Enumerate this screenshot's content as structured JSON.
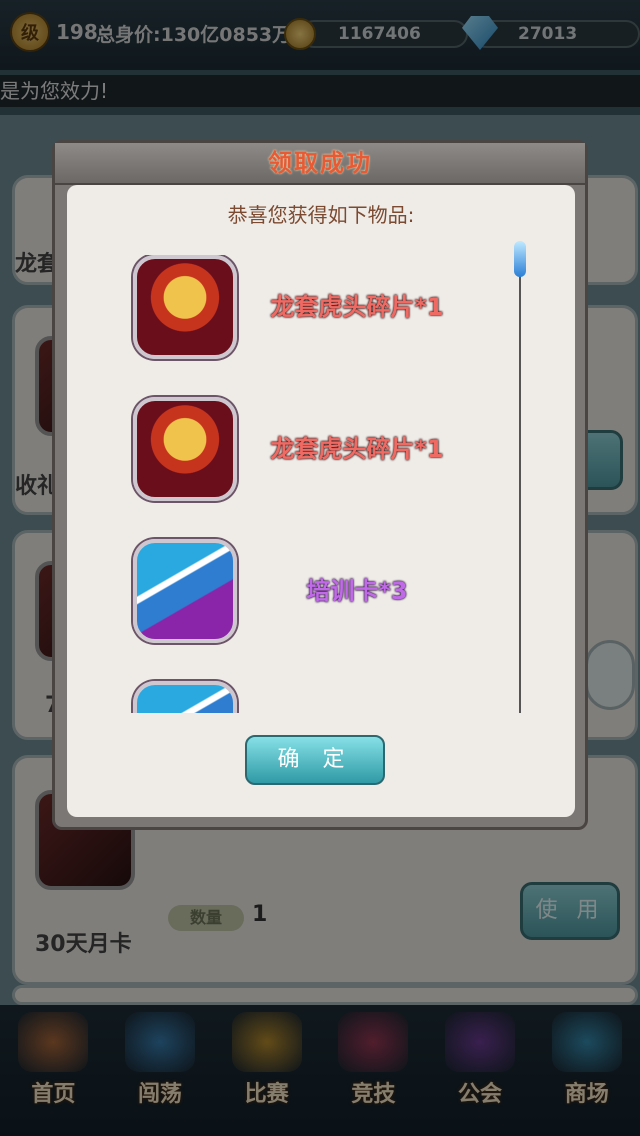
{
  "topbar": {
    "level_badge": "级",
    "level": "198",
    "total_value": "总身价:130亿0853万",
    "coins": "1167406",
    "gems": "27013",
    "ticker": "是为您效力!"
  },
  "background": {
    "item1_label": "龙套",
    "item2_label": "收礼",
    "item3_label": "7",
    "item4_label": "30天月卡",
    "qty_label": "数量",
    "qty_value": "1",
    "use_button": "使 用"
  },
  "modal": {
    "title": "领取成功",
    "subtitle": "恭喜您获得如下物品:",
    "rewards": [
      {
        "name": "龙套虎头碎片*1",
        "icon": "tiger-mask-icon",
        "color": "#f06a64"
      },
      {
        "name": "龙套虎头碎片*1",
        "icon": "tiger-mask-icon",
        "color": "#f06a64"
      },
      {
        "name": "培训卡*3",
        "icon": "training-card-icon",
        "color": "#c06ae8"
      },
      {
        "name": "",
        "icon": "training-card-icon",
        "color": "#c06ae8"
      }
    ],
    "confirm_button": "确 定"
  },
  "bottom_nav": [
    {
      "label": "首页",
      "icon": "home-icon"
    },
    {
      "label": "闯荡",
      "icon": "airplane-icon"
    },
    {
      "label": "比赛",
      "icon": "lightning-icon"
    },
    {
      "label": "竞技",
      "icon": "throne-icon"
    },
    {
      "label": "公会",
      "icon": "guild-icon"
    },
    {
      "label": "商场",
      "icon": "shop-icon"
    }
  ]
}
